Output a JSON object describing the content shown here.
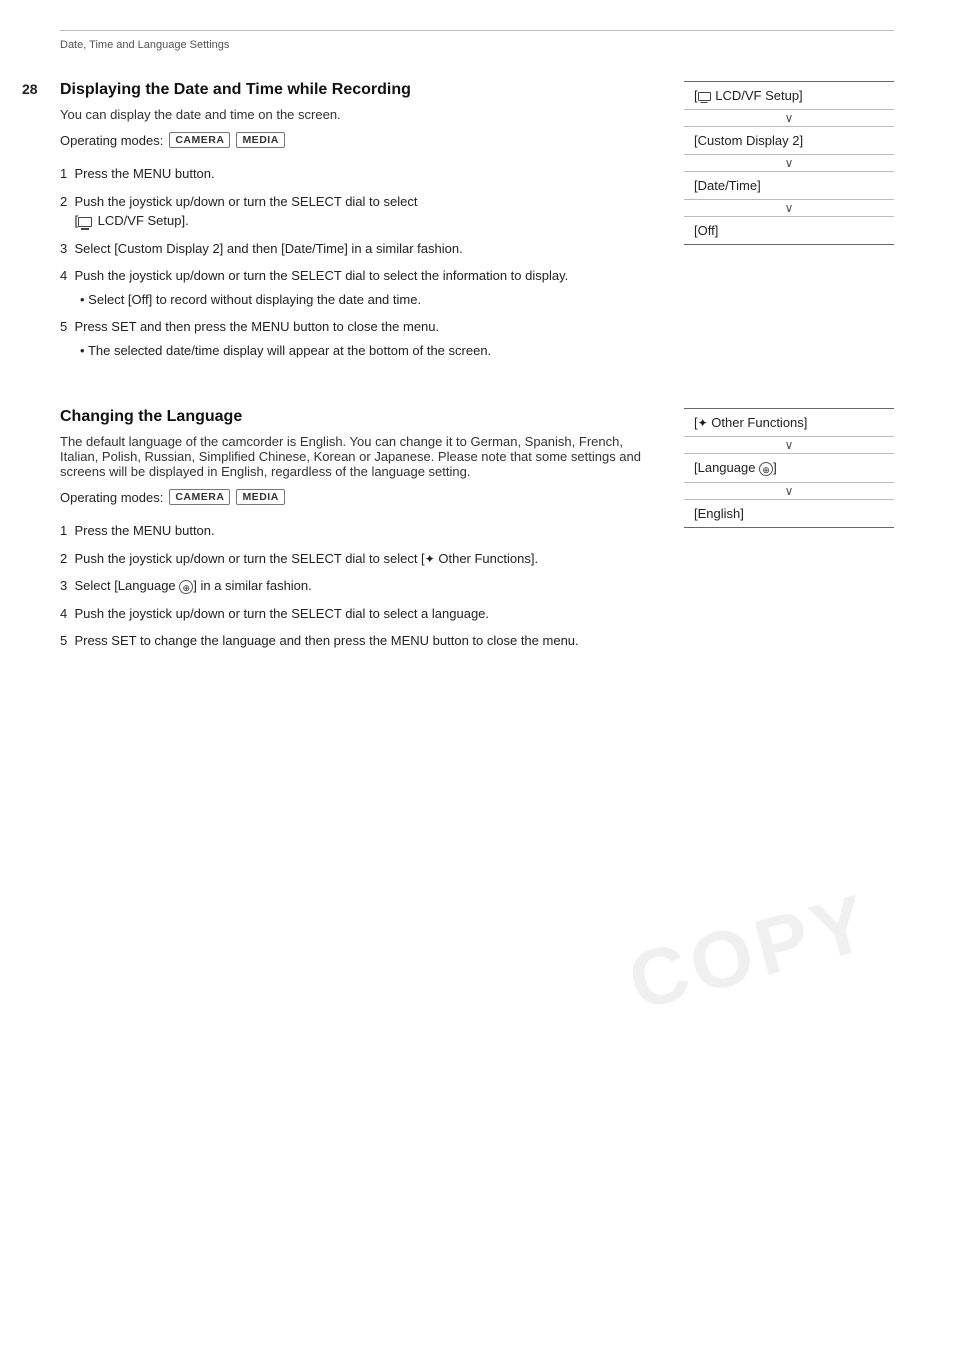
{
  "breadcrumb": "Date, Time and Language Settings",
  "pageNumber": "28",
  "section1": {
    "title": "Displaying the Date and Time while Recording",
    "intro": "You can display the date and time on the screen.",
    "operatingModes": {
      "label": "Operating modes:",
      "modes": [
        "CAMERA",
        "MEDIA"
      ]
    },
    "steps": [
      "1  Press the MENU button.",
      "2  Push the joystick up/down or turn the SELECT dial to select\n[  LCD/VF Setup].",
      "3  Select [Custom Display 2] and then [Date/Time] in a similar fashion.",
      "4  Push the joystick up/down or turn the SELECT dial to select the information to display.",
      "4a  Select [Off] to record without displaying the date and time.",
      "5  Press SET and then press the MENU button to close the menu.",
      "5a  The selected date/time display will appear at the bottom of the screen."
    ],
    "menuChain": [
      {
        "label": "[ LCD/VF Setup]",
        "type": "item"
      },
      {
        "label": "arrow",
        "type": "arrow"
      },
      {
        "label": "[Custom Display 2]",
        "type": "item"
      },
      {
        "label": "arrow",
        "type": "arrow"
      },
      {
        "label": "[Date/Time]",
        "type": "item"
      },
      {
        "label": "arrow",
        "type": "arrow"
      },
      {
        "label": "[Off]",
        "type": "item"
      }
    ]
  },
  "section2": {
    "title": "Changing the Language",
    "intro": "The default language of the camcorder is English. You can change it to German, Spanish, French, Italian, Polish, Russian, Simplified Chinese, Korean or Japanese. Please note that some settings and screens will be displayed in English, regardless of the language setting.",
    "operatingModes": {
      "label": "Operating modes:",
      "modes": [
        "CAMERA",
        "MEDIA"
      ]
    },
    "steps": [
      "1  Press the MENU button.",
      "2  Push the joystick up/down or turn the SELECT dial to select [♦ Other Functions].",
      "3  Select [Language  ] in a similar fashion.",
      "4  Push the joystick up/down or turn the SELECT dial to select a language.",
      "5  Press SET to change the language and then press the MENU button to close the menu."
    ],
    "menuChain": [
      {
        "label": "[♦ Other Functions]",
        "type": "item"
      },
      {
        "label": "arrow",
        "type": "arrow"
      },
      {
        "label": "[Language Ⓟ]",
        "type": "item"
      },
      {
        "label": "arrow",
        "type": "arrow"
      },
      {
        "label": "[English]",
        "type": "item"
      }
    ]
  }
}
